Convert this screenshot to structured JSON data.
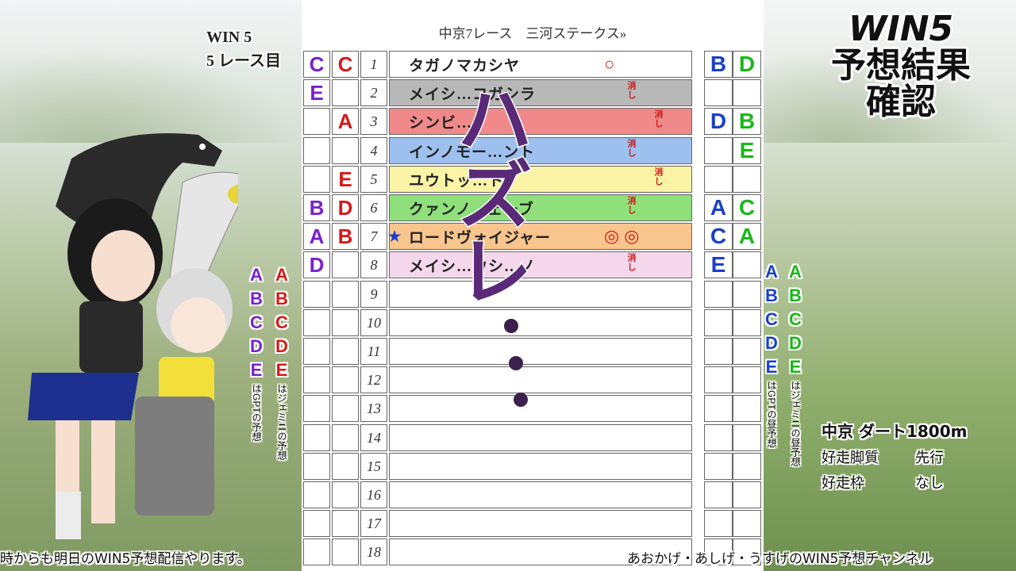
{
  "header": {
    "win5_line1": "WIN 5",
    "win5_line2": "5 レース目",
    "race_title": "中京7レース　三河ステークス»"
  },
  "big_title": {
    "line1": "WIN5",
    "line2": "予想結果",
    "line3": "確認"
  },
  "stamp_text": "ハズレ",
  "rows": [
    {
      "m1": "C",
      "c1": "#7a1fd0",
      "m2": "C",
      "c2": "#d81818",
      "num": "1",
      "name": "タガノマカシヤ",
      "bg": "#ffffff",
      "mark": "○",
      "keshi": "",
      "r1": "B",
      "rc1": "#1a3fc8",
      "r2": "D",
      "rc2": "#18b818"
    },
    {
      "m1": "E",
      "c1": "#7a1fd0",
      "m2": "",
      "c2": "",
      "num": "2",
      "name": "メイシ…コガシラ",
      "bg": "#b8b8b8",
      "mark": "",
      "keshi": "消し",
      "r1": "",
      "rc1": "",
      "r2": "",
      "rc2": ""
    },
    {
      "m1": "",
      "c1": "",
      "m2": "A",
      "c2": "#d81818",
      "num": "3",
      "name": "シンビ…",
      "bg": "#f08a8a",
      "mark": "",
      "keshi": "消し",
      "r1": "D",
      "rc1": "#1a3fc8",
      "r2": "B",
      "rc2": "#18b818"
    },
    {
      "m1": "",
      "c1": "",
      "m2": "",
      "c2": "",
      "num": "4",
      "name": "インノモー…ント",
      "bg": "#9ec0ee",
      "mark": "",
      "keshi": "消し",
      "r1": "",
      "rc1": "",
      "r2": "E",
      "rc2": "#18b818"
    },
    {
      "m1": "",
      "c1": "",
      "m2": "E",
      "c2": "#d81818",
      "num": "5",
      "name": "ユウトッ…ト",
      "bg": "#fbf3a6",
      "mark": "",
      "keshi": "消し",
      "r1": "",
      "rc1": "",
      "r2": "",
      "rc2": ""
    },
    {
      "m1": "B",
      "c1": "#7a1fd0",
      "m2": "D",
      "c2": "#d81818",
      "num": "6",
      "name": "クァンノ…ェーブ",
      "bg": "#8fe07a",
      "mark": "",
      "keshi": "消し",
      "r1": "A",
      "rc1": "#1a3fc8",
      "r2": "C",
      "rc2": "#18b818"
    },
    {
      "m1": "A",
      "c1": "#7a1fd0",
      "m2": "B",
      "c2": "#d81818",
      "num": "7",
      "name": "ロードヴォイジャー",
      "bg": "#f8c58e",
      "mark": "◎◎",
      "keshi": "",
      "r1": "C",
      "rc1": "#1a3fc8",
      "r2": "A",
      "rc2": "#18b818"
    },
    {
      "m1": "D",
      "c1": "#7a1fd0",
      "m2": "",
      "c2": "",
      "num": "8",
      "name": "メイシ…ウシ…ノ",
      "bg": "#f4d7ea",
      "mark": "",
      "keshi": "消し",
      "r1": "E",
      "rc1": "#1a3fc8",
      "r2": "",
      "rc2": ""
    },
    {
      "num": "9"
    },
    {
      "num": "10"
    },
    {
      "num": "11"
    },
    {
      "num": "12"
    },
    {
      "num": "13"
    },
    {
      "num": "14"
    },
    {
      "num": "15"
    },
    {
      "num": "16"
    },
    {
      "num": "17"
    },
    {
      "num": "18"
    }
  ],
  "legend_left": {
    "gpt_letters": [
      "A",
      "B",
      "C",
      "D",
      "E"
    ],
    "gpt_note": "はGPTの予想",
    "gemini_letters": [
      "A",
      "B",
      "C",
      "D",
      "E"
    ],
    "gemini_note": "はジェミニの予想",
    "gpt_color": "#7a1fd0",
    "gemini_color": "#d81818"
  },
  "legend_right": {
    "gpt_letters": [
      "A",
      "B",
      "C",
      "D",
      "E"
    ],
    "gpt_note": "はGPTの昼予想",
    "gemini_letters": [
      "A",
      "B",
      "C",
      "D",
      "E"
    ],
    "gemini_note": "はジェミニの昼予想",
    "gpt_color": "#1a3fc8",
    "gemini_color": "#18b818"
  },
  "race_info": {
    "course": "中京 ダート1800m",
    "style_label": "好走脚質",
    "style_value": "先行",
    "gate_label": "好走枠",
    "gate_value": "なし"
  },
  "footer": {
    "left": "時からも明日のWIN5予想配信やります。",
    "right": "あおかげ・あしげ・うすげのWIN5予想チャンネル"
  },
  "star_color": "#1a3fc8"
}
